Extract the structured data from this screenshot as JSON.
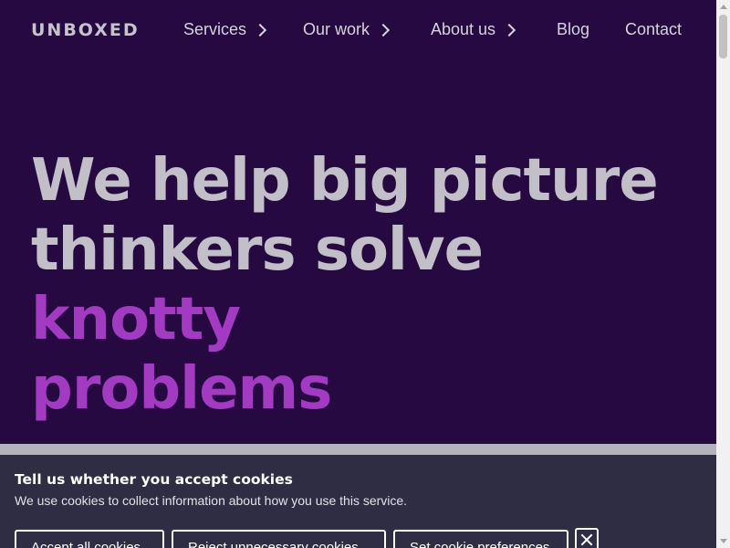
{
  "header": {
    "logo": "UNBOXED",
    "nav": [
      {
        "label": "Services",
        "has_submenu": true
      },
      {
        "label": "Our work",
        "has_submenu": true
      },
      {
        "label": "About us",
        "has_submenu": true
      },
      {
        "label": "Blog",
        "has_submenu": false
      },
      {
        "label": "Contact",
        "has_submenu": false
      }
    ]
  },
  "hero": {
    "line1": "We help big picture",
    "line2_plain": "thinkers solve ",
    "line2_accent": "knotty",
    "line3_accent": "problems"
  },
  "cookie_banner": {
    "title": "Tell us whether you accept cookies",
    "text": "We use cookies to collect information about how you use this service.",
    "accept_label": "Accept all cookies",
    "reject_label": "Reject unnecessary cookies",
    "preferences_label": "Set cookie preferences",
    "close_icon": "close-icon"
  },
  "colors": {
    "background": "#250940",
    "hero_text": "#c3bfc9",
    "accent": "#a23ac2",
    "banner_background": "#2f2d44"
  }
}
